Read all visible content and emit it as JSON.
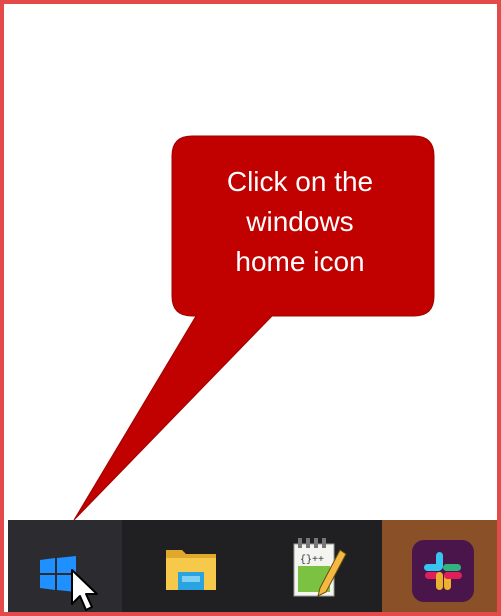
{
  "callout": {
    "text": "Click on the\nwindows\nhome icon",
    "fill_color": "#c10000",
    "text_color": "#ffffff"
  },
  "frame": {
    "border_color": "#e34b4b"
  },
  "taskbar": {
    "items": [
      {
        "name": "start",
        "icon": "windows-logo-icon"
      },
      {
        "name": "file-explorer",
        "icon": "folder-icon"
      },
      {
        "name": "notepad-plus-plus",
        "icon": "notepad-icon"
      },
      {
        "name": "slack",
        "icon": "slack-icon"
      }
    ],
    "background": "#202023",
    "highlight": "#2c2c30",
    "slack_bg": "#8a5128",
    "active_underline": "#8fb6e0"
  },
  "cursor": {
    "icon": "mouse-pointer-icon"
  }
}
